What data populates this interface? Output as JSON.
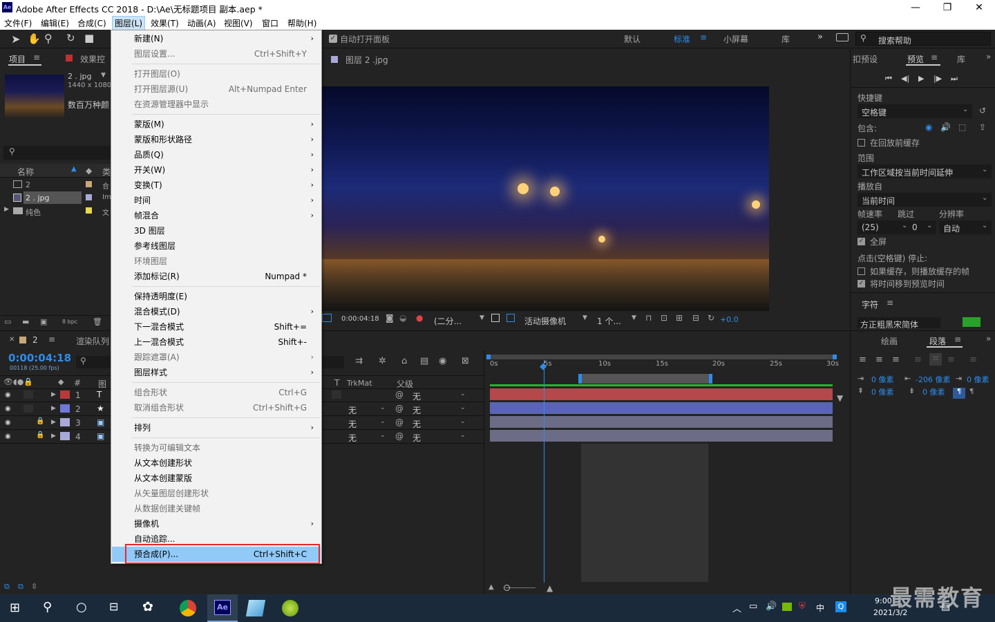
{
  "window": {
    "title": "Adobe After Effects CC 2018 - D:\\Ae\\无标题项目 副本.aep *",
    "logo": "Ae",
    "controls": [
      "—",
      "❐",
      "✕"
    ]
  },
  "menubar": [
    "文件(F)",
    "编辑(E)",
    "合成(C)",
    "图层(L)",
    "效果(T)",
    "动画(A)",
    "视图(V)",
    "窗口",
    "帮助(H)"
  ],
  "toolbar": {
    "auto_open": "自动打开面板",
    "workspaces": [
      "默认",
      "标准",
      "小屏幕",
      "库"
    ],
    "active_workspace": "标准",
    "search_help": "搜索帮助"
  },
  "project": {
    "tab": "项目",
    "effects_tab": "效果控",
    "asset_name": "2 . jpg",
    "asset_dims": "1440 x 1080",
    "asset_desc": "数百万种颜",
    "col_name": "名称",
    "col_type": "类",
    "bpc": "8 bpc",
    "items": [
      {
        "name": "2",
        "type": "合"
      },
      {
        "name": "2 . jpg",
        "type": "Im"
      },
      {
        "name": "纯色",
        "type": "文"
      }
    ]
  },
  "viewer": {
    "tab": "图层 2 .jpg",
    "timecode": "0:00:04:18",
    "resolution": "(二分...",
    "camera": "活动摄像机",
    "views": "1 个...",
    "exposure": "+0.0"
  },
  "timeline": {
    "tab": "2",
    "render_tab": "渲染队列",
    "timecode": "0:00:04:18",
    "frames": "00118 (25.00 fps)",
    "col_source": "图",
    "col_trkmat": "TrkMat",
    "col_parent": "父级",
    "layers": [
      {
        "num": "1",
        "type": "T",
        "trk": "",
        "parent": "无",
        "color": "#b73a3a"
      },
      {
        "num": "2",
        "type": "★",
        "trk": "无",
        "parent": "无",
        "color": "#7078d8"
      },
      {
        "num": "3",
        "type": "▣",
        "trk": "无",
        "parent": "无",
        "color": "#a9a9d8"
      },
      {
        "num": "4",
        "type": "▣",
        "trk": "无",
        "parent": "无",
        "color": "#a9a9d8"
      }
    ],
    "ruler": [
      "0s",
      "5s",
      "10s",
      "15s",
      "20s",
      "25s",
      "30s"
    ]
  },
  "preview": {
    "tab_presets": "扣预设",
    "tab": "预览",
    "tab_lib": "库",
    "shortcut_label": "快捷键",
    "shortcut_value": "空格键",
    "include_label": "包含:",
    "cache_before": "在回放前缓存",
    "range_label": "范围",
    "range_value": "工作区域按当前时间延伸",
    "play_from_label": "播放自",
    "play_from_value": "当前时间",
    "fps_label": "帧速率",
    "skip_label": "跳过",
    "res_label": "分辨率",
    "fps_value": "(25)",
    "skip_value": "0",
    "res_value": "自动",
    "fullscreen": "全屏",
    "stop_label": "点击(空格键) 停止:",
    "if_cache": "如果缓存，则播放缓存的帧",
    "move_time": "将时间移到预览时间"
  },
  "character": {
    "tab": "字符",
    "font": "方正粗黑宋简体"
  },
  "paragraph": {
    "tab_draw": "绘画",
    "tab": "段落",
    "indent1": "0 像素",
    "indent2": "-206 像素",
    "indent3": "0 像素",
    "space1": "0 像素",
    "space2": "0 像素"
  },
  "menu": {
    "items": [
      {
        "label": "新建(N)",
        "arrow": true
      },
      {
        "label": "图层设置...",
        "shortcut": "Ctrl+Shift+Y",
        "disabled": true
      },
      {
        "sep": true
      },
      {
        "label": "打开图层(O)",
        "disabled": true
      },
      {
        "label": "打开图层源(U)",
        "shortcut": "Alt+Numpad Enter",
        "disabled": true
      },
      {
        "label": "在资源管理器中显示",
        "disabled": true
      },
      {
        "sep": true
      },
      {
        "label": "蒙版(M)",
        "arrow": true
      },
      {
        "label": "蒙版和形状路径",
        "arrow": true
      },
      {
        "label": "品质(Q)",
        "arrow": true
      },
      {
        "label": "开关(W)",
        "arrow": true
      },
      {
        "label": "变换(T)",
        "arrow": true
      },
      {
        "label": "时间",
        "arrow": true
      },
      {
        "label": "帧混合",
        "arrow": true
      },
      {
        "label": "3D 图层"
      },
      {
        "label": "参考线图层"
      },
      {
        "label": "环境图层",
        "disabled": true
      },
      {
        "label": "添加标记(R)",
        "shortcut": "Numpad *"
      },
      {
        "sep": true
      },
      {
        "label": "保持透明度(E)"
      },
      {
        "label": "混合模式(D)",
        "arrow": true
      },
      {
        "label": "下一混合模式",
        "shortcut": "Shift+="
      },
      {
        "label": "上一混合模式",
        "shortcut": "Shift+-"
      },
      {
        "label": "跟踪遮罩(A)",
        "arrow": true,
        "disabled": true
      },
      {
        "label": "图层样式",
        "arrow": true
      },
      {
        "sep": true
      },
      {
        "label": "组合形状",
        "shortcut": "Ctrl+G",
        "disabled": true
      },
      {
        "label": "取消组合形状",
        "shortcut": "Ctrl+Shift+G",
        "disabled": true
      },
      {
        "sep": true
      },
      {
        "label": "排列",
        "arrow": true
      },
      {
        "sep": true
      },
      {
        "label": "转换为可编辑文本",
        "disabled": true
      },
      {
        "label": "从文本创建形状"
      },
      {
        "label": "从文本创建蒙版"
      },
      {
        "label": "从矢量图层创建形状",
        "disabled": true
      },
      {
        "label": "从数据创建关键帧",
        "disabled": true
      },
      {
        "label": "摄像机",
        "arrow": true
      },
      {
        "label": "自动追踪..."
      },
      {
        "label": "预合成(P)...",
        "shortcut": "Ctrl+Shift+C",
        "highlight": true
      }
    ]
  },
  "taskbar": {
    "time": "9:00",
    "date": "2021/3/2",
    "ime": "中",
    "watermark": "最需教育"
  }
}
